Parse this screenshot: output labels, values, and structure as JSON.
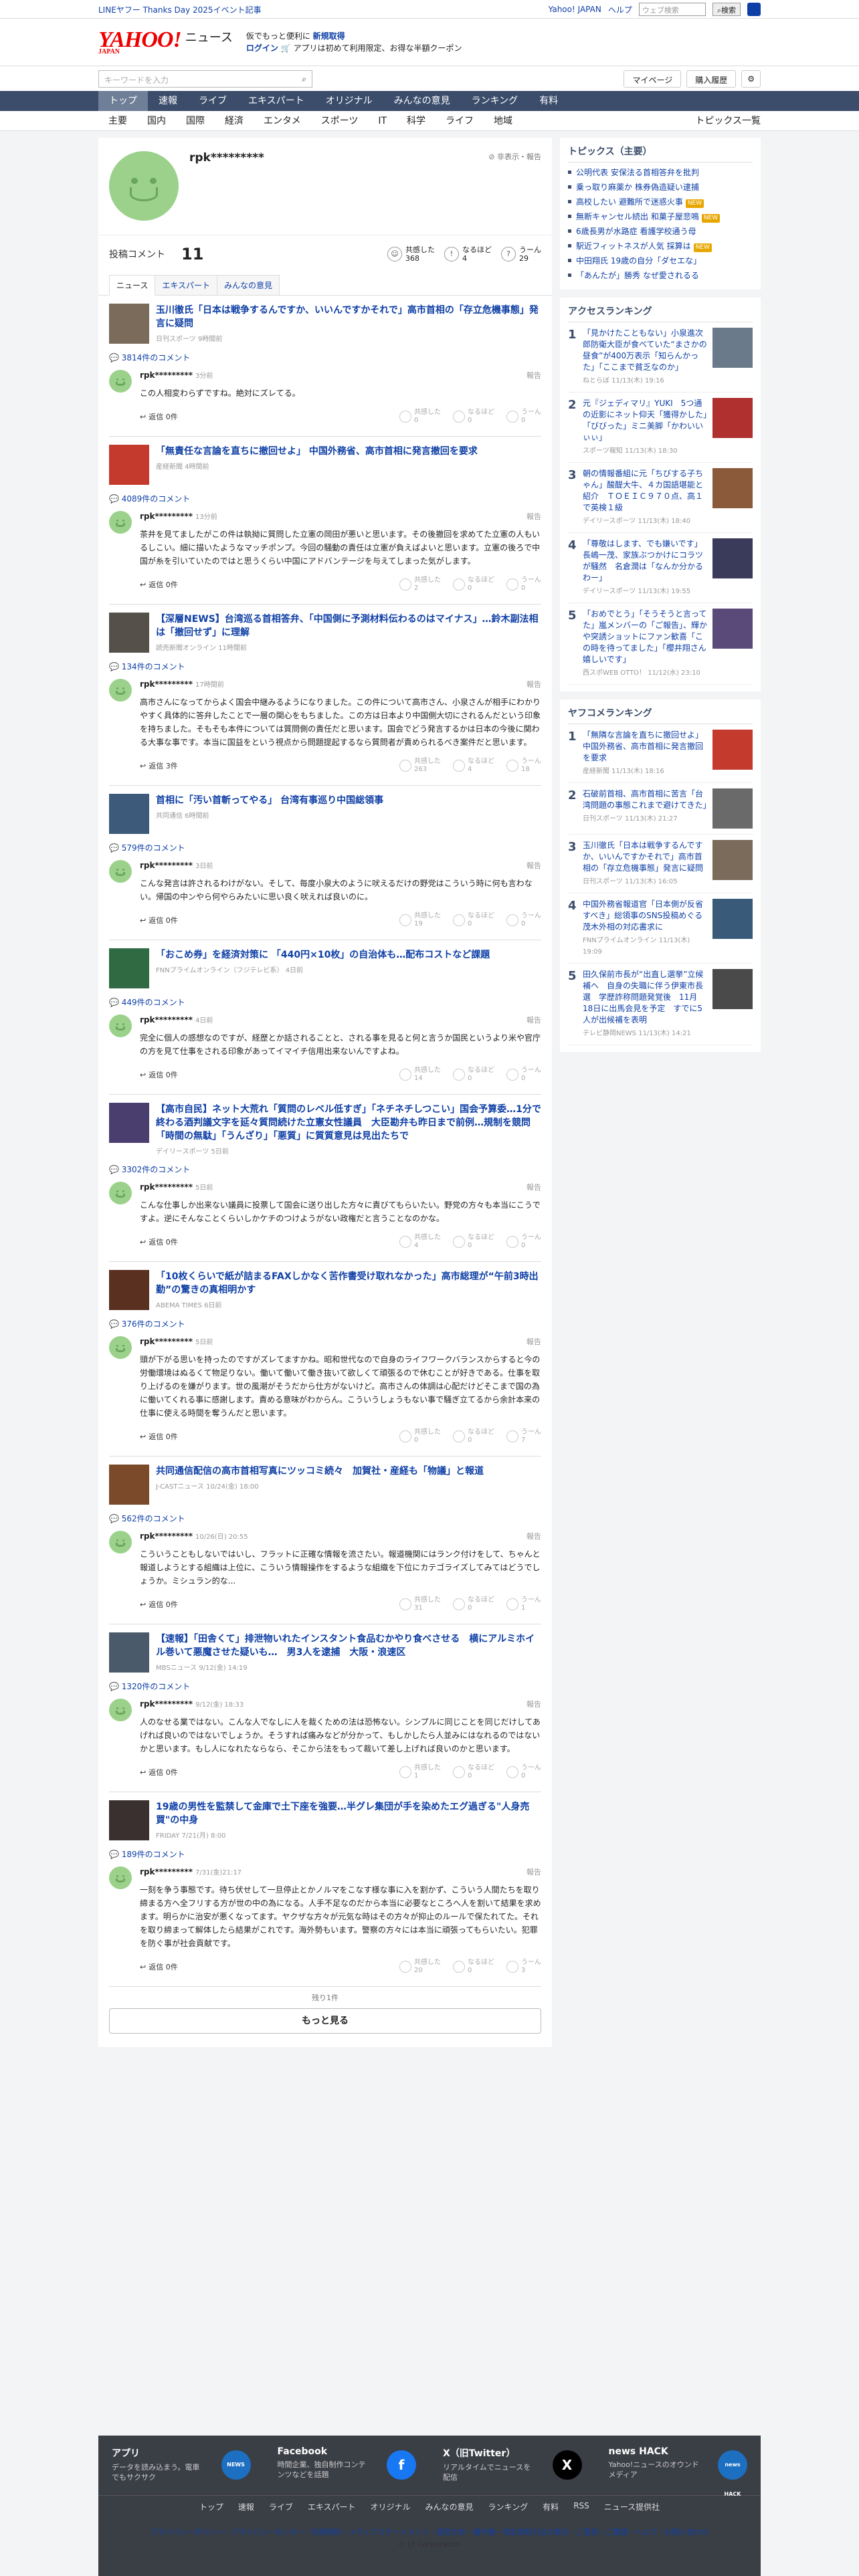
{
  "topbar": {
    "left": "LINEヤフー Thanks Day 2025イベント記事",
    "links": [
      "Yahoo! JAPAN",
      "ヘルプ"
    ],
    "search_placeholder": "ウェブ検索",
    "search_btn": "検索"
  },
  "header": {
    "logo": "YAHOO!",
    "logo_sub": "JAPAN",
    "service": "ニュース",
    "promo_line1": "仮でもっと便利に",
    "promo_line1_link": "新規取得",
    "promo_line2_login": "ログイン",
    "promo_line2": "アプリは初めて利用限定、お得な半額クーポン"
  },
  "subheader": {
    "keyword_placeholder": "キーワードを入力",
    "mypage": "マイページ",
    "history": "購入履歴"
  },
  "nav": [
    {
      "label": "トップ"
    },
    {
      "label": "速報"
    },
    {
      "label": "ライブ"
    },
    {
      "label": "エキスパート"
    },
    {
      "label": "オリジナル"
    },
    {
      "label": "みんなの意見"
    },
    {
      "label": "ランキング"
    },
    {
      "label": "有料"
    }
  ],
  "subnav": {
    "items": [
      "主要",
      "国内",
      "国際",
      "経済",
      "エンタメ",
      "スポーツ",
      "IT",
      "科学",
      "ライフ",
      "地域"
    ],
    "right": "トピックス一覧"
  },
  "profile": {
    "name": "rpk*********",
    "report": "非表示・報告",
    "comments_label": "投稿コメント",
    "comments_count": "11",
    "reactions": [
      {
        "icon": "☺",
        "label": "共感した",
        "count": "368"
      },
      {
        "icon": "!",
        "label": "なるほど",
        "count": "4"
      },
      {
        "icon": "?",
        "label": "うーん",
        "count": "29"
      }
    ]
  },
  "tabs": [
    "ニュース",
    "エキスパート",
    "みんなの意見"
  ],
  "entries": [
    {
      "title": "玉川徹氏「日本は戦争するんですか、いいんですかそれで」高市首相の「存立危機事態」発言に疑問",
      "source": "日刊スポーツ 9時間前",
      "ccount": "3814件のコメント",
      "time": "3分前",
      "text": "この人相変わらずですね。絶対にズレてる。",
      "counts": [
        "0",
        "0",
        "0"
      ],
      "reply": "返信 0件",
      "thumb": "#7a6b5a"
    },
    {
      "title": "「無責任な言論を直ちに撤回せよ」 中国外務省、高市首相に発言撤回を要求",
      "source": "産経新聞 4時間前",
      "ccount": "4089件のコメント",
      "time": "13分前",
      "text": "茶井を見てましたがこの件は執拗に質問した立憲の岡田が悪いと思います。その後撤回を求めてた立憲の人もいるしこい。細に描いたようなマッチポンプ。今回の騒動の責任は立憲が負えばよいと思います。立憲の後ろで中国が糸を引いていたのではと思うくらい中国にアドバンテージを与えてしまった気がします。",
      "counts": [
        "2",
        "0",
        "0"
      ],
      "reply": "返信 0件",
      "thumb": "#c43a2d"
    },
    {
      "title": "【深層NEWS】台湾巡る首相答弁、「中国側に予測材料伝わるのはマイナス」…鈴木副法相は「撤回せず」に理解",
      "source": "読売新聞オンライン 11時間前",
      "ccount": "134件のコメント",
      "time": "17時間前",
      "text": "高市さんになってからよく国会中継みるようになりました。この件について高市さん、小泉さんが相手にわかりやすく具体的に答弁したことで一層の関心をもちました。この方は日本より中国側大切にされるんだという印象を持ちました。そもそも本件については質問側の責任だと思います。国会でどう発言するかは日本の今後に関わる大事な事です。本当に国益をという視点から問題提起するなら質問者が責められるべき案件だと思います。",
      "counts": [
        "263",
        "4",
        "18"
      ],
      "reply": "返信 3件",
      "thumb": "#55504a"
    },
    {
      "title": "首相に「汚い首斬ってやる」 台湾有事巡り中国総領事",
      "source": "共同通信 6時間前",
      "ccount": "579件のコメント",
      "time": "3日前",
      "text": "こんな発言は許されるわけがない。そして、毎度小泉大のように吠えるだけの野党はこういう時に何も言わない。帰国の中ンやら何やらみたいに思い良く吠えれば良いのに。",
      "counts": [
        "19",
        "0",
        "0"
      ],
      "reply": "返信 0件",
      "thumb": "#3d5a7a"
    },
    {
      "title": "「おこめ券」を経済対策に 「440円×10枚」の自治体も…配布コストなど課題",
      "source": "FNNプライムオンライン（フジテレビ系） 4日前",
      "ccount": "449件のコメント",
      "time": "4日前",
      "text": "完全に個人の感想なのですが、経歴とか話されることと、される事を見ると何と言うか国民というより米や官庁の方を見て仕事をされる印象があってイマイチ信用出来ないんですよね。",
      "counts": [
        "14",
        "0",
        "0"
      ],
      "reply": "返信 0件",
      "thumb": "#2f6a42"
    },
    {
      "title": "【高市自民】ネット大荒れ「質問のレベル低すぎ」「ネチネチしつこい」国会予算委…1分で終わる酒判議文字を延々質問続けた立憲女性議員　大臣勘弁も昨日まで前例…規制を競問「時間の無駄」「うんざり」「悪質」に質質意見は見出たちで",
      "source": "デイリースポーツ 5日前",
      "ccount": "3302件のコメント",
      "time": "5日前",
      "text": "こんな仕事しか出来ない議員に投票して国会に送り出した方々に責びてもらいたい。野党の方々も本当にこうですよ。逆にそんなことくらいしかケチのつけようがない政権だと言うことなのかな。",
      "counts": [
        "4",
        "0",
        "0"
      ],
      "reply": "返信 0件",
      "thumb": "#4a3e6e"
    },
    {
      "title": "「10枚くらいで紙が詰まるFAXしかなく苦作書受け取れなかった」高市総理が“午前3時出勤”の驚きの真相明かす",
      "source": "ABEMA TIMES 6日前",
      "ccount": "376件のコメント",
      "time": "5日前",
      "text": "頭が下がる思いを持ったのですがズレてますかね。昭和世代なので自身のライフワークバランスからすると今の労働環境はぬるくて物足りない。働いて働いて働き抜いて欲しくて頑張るので休むことが好きである。仕事を取り上げるのを嫌がります。世の風潮がそうだから仕方がないけど。高市さんの体調は心配だけどそこまで国の為に働いてくれる事に感謝します。責める意味がわからん。こういうしょうもない事で騒ぎ立てるから余計本来の仕事に使える時間を奪うんだと思います。",
      "counts": [
        "0",
        "0",
        "7"
      ],
      "reply": "返信 0件",
      "thumb": "#5a3020"
    },
    {
      "title": "共同通信配信の高市首相写真にツッコミ続々　加賀社・産経も「物議」と報道",
      "source": "J-CASTニュース 10/24(金) 18:00",
      "ccount": "562件のコメント",
      "time": "10/26(日) 20:55",
      "text": "こういうこともしないではいし、フラットに正確な情報を流さたい。報道機関にはランク付けをして、ちゃんと報道しようとする組織は上位に、こういう情報操作をするような組織を下位にカテゴライズしてみてはどうでしょうか。ミシュラン的な...",
      "counts": [
        "31",
        "0",
        "1"
      ],
      "reply": "返信 0件",
      "thumb": "#7a4a2a"
    },
    {
      "title": "【速報】「田舎くて」排泄物いれたインスタント食品むかやり食べさせる　横にアルミホイル巻いて悪魔させた疑いも…　男3人を逮捕　大阪・浪速区",
      "source": "MBSニュース 9/12(金) 14:19",
      "ccount": "1320件のコメント",
      "time": "9/12(金) 18:33",
      "text": "人のなせる業ではない。こんな人でなしに人を裁くための法は恐怖ない。シンプルに同じことを同じだけしてあげれば良いのではないでしょうか。そうすれば痛みなどが分かって、もしかしたら人並みにはなれるのではないかと思います。もし人になれたならなら、そこから法をもって裁いて差し上げれば良いのかと思います。",
      "counts": [
        "1",
        "0",
        "0"
      ],
      "reply": "返信 0件",
      "thumb": "#4a5a6a"
    },
    {
      "title": "19歳の男性を監禁して金庫で土下座を強要…半グレ集団が手を染めたエグ過ぎる\"人身売買\"の中身",
      "source": "FRIDAY 7/21(月) 8:00",
      "ccount": "189件のコメント",
      "time": "7/31(金)21:17",
      "text": "一刻を争う事態です。待ち伏せして一旦停止とかノルマをこなす様な事に入を割かず、こういう人間たちを取り締まる方へ全フリする方が世の中の為になる。人手不足なのだから本当に必要なところへ人を割いて結果を求めます。明らかに治安が悪くなってます。ヤクザな方々が元気な時はその方々が抑止のルールで保たれてた。それを取り締まって解体したら結果がこれです。海外勢もいます。警察の方々には本当に頑張ってもらいたい。犯罪を防ぐ事が社会貢献です。",
      "counts": [
        "20",
        "0",
        "3"
      ],
      "reply": "返信 0件",
      "thumb": "#3a3030"
    }
  ],
  "more": {
    "note": "残り1件",
    "button": "もっと見る"
  },
  "topics": {
    "title": "トピックス（主要）",
    "items": [
      {
        "t": "公明代表 安保法る首相答弁を批判",
        "b": ""
      },
      {
        "t": "乗っ取り麻薬か 株券偽造疑い逮捕",
        "b": ""
      },
      {
        "t": "高校したい 避難所で迷惑火事",
        "b": "NEW"
      },
      {
        "t": "無断キャンセル続出 和菓子屋悲鳴",
        "b": "NEW"
      },
      {
        "t": "6歳長男が水路症 看護学校通う母",
        "b": ""
      },
      {
        "t": "駅近フィットネスが人気 採算は",
        "b": "NEW"
      },
      {
        "t": "中田翔氏 19歳の自分「ダセエな」",
        "b": ""
      },
      {
        "t": "「あんたが」勝秀 なぜ愛されるる",
        "b": ""
      }
    ]
  },
  "access_ranking": {
    "title": "アクセスランキング",
    "items": [
      {
        "t": "「見かけたこともない」小泉進次郎防衛大臣が食べていた“まさかの昼食”が400万表示「知らんかった」「ここまで貧乏なのか」",
        "s": "ねとらぼ 11/13(木) 19:16",
        "c": "#6a7a8a"
      },
      {
        "t": "元『ジェディマリ』YUKI　5つ通の近影にネット仰天「獲得かした」「びびった」ミニ美脚「かわいいぃぃ」",
        "s": "スポーツ報知 11/13(木) 18:30",
        "c": "#b03030"
      },
      {
        "t": "朝の情報番組に元「ちびする子ちゃん」酸醍大牛、４カ国語堪能と紹介　ＴＯＥＩＣ９７０点、高１で英検１級",
        "s": "デイリースポーツ 11/13(木) 18:40",
        "c": "#8a5a3a"
      },
      {
        "t": "「尊敬はします、でも嫌いです」長嶋一茂、家族ぶつかけにコラツが騒然　名倉潤は「なんか分かるわー」",
        "s": "デイリースポーツ 11/13(木) 19:55",
        "c": "#3a3a5a"
      },
      {
        "t": "「おめでとう」「そうそうと言ってた」嵐メンバーの「ご報告」、輝かや突誘ショットにファン歓喜「この時を待ってました」「櫻井翔さん嬉しいです」",
        "s": "西スポWEB OTTO！ 11/12(水) 23:10",
        "c": "#5a4a7a"
      }
    ]
  },
  "yahoo_ranking": {
    "title": "ヤフコメランキング",
    "items": [
      {
        "t": "「無隣な言論を直ちに撤回せよ」中国外務省、高市首相に発言撤回を要求",
        "s": "産経新聞 11/13(木) 18:16",
        "c": "#c43a2d"
      },
      {
        "t": "石破前首相、高市首相に苦言「台湾問題の事態これまで避けてきた」",
        "s": "日刊スポーツ 11/13(木) 21:27",
        "c": "#6a6a6a"
      },
      {
        "t": "玉川徹氏「日本は戦争するんですか、いいんですかそれで」高市首相の「存立危機事態」発言に疑問",
        "s": "日刊スポーツ 11/13(木) 16:05",
        "c": "#7a6b5a"
      },
      {
        "t": "中国外務省報道官「日本側が反省すべき」総領事のSNS投稿めぐる茂木外相の対応書求に",
        "s": "FNNプライムオンライン 11/13(木) 19:09",
        "c": "#3a5a7a"
      },
      {
        "t": "田久保前市長が“出直し選挙”立候補へ　自身の失職に伴う伊東市長選　学歴詐称問題発覚後　11月18日に出馬会見を予定　すでに5人が出候補を表明",
        "s": "テレビ静岡NEWS 11/13(木) 14:21",
        "c": "#4a4a4a"
      }
    ]
  },
  "footer": {
    "apps": [
      {
        "name": "アプリ",
        "desc": "データを読み込まう。電車でもサクサク",
        "icon": "#1d6fc1",
        "iconText": "NEWS"
      },
      {
        "name": "Facebook",
        "desc": "時間企業、独自制作コンテンツなどを話題",
        "icon": "#1877f2",
        "iconText": "f"
      },
      {
        "name": "X（旧Twitter）",
        "desc": "リアルタイムでニュースを配信",
        "icon": "#000000",
        "iconText": "X"
      },
      {
        "name": "news HACK",
        "desc": "Yahoo!ニュースのオウンドメディア",
        "icon": "#1d6fc1",
        "iconText": "news HACK"
      }
    ],
    "links": [
      "トップ",
      "速報",
      "ライブ",
      "エキスパート",
      "オリジナル",
      "みんなの意見",
      "ランキング",
      "有料",
      "RSS",
      "ニュース提供社"
    ],
    "legal": "プライバシーポリシー・プライバシーセンター・利用規約・メディアステートメント・運営方針・著作権・特定商取引法の表示・ご意見・ご要望・ヘルプ・お問い合わせ",
    "copyright": "© LY Corporation"
  }
}
